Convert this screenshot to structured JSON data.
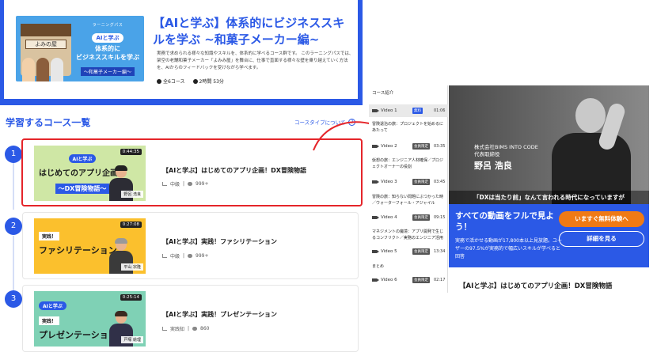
{
  "banner": {
    "hero_small": "ラーニングパス",
    "hero_ai": "AIと学ぶ",
    "hero_main": "体系的に\nビジネススキルを学ぶ",
    "hero_sub": "〜和菓子メーカー編〜",
    "hero_sign": "よみの屋",
    "title": "【AIと学ぶ】体系的にビジネススキルを学ぶ ~和菓子メーカー編~",
    "description": "実務で求められる様々な知識やスキルを、体系的に学べるコース群です。 このラーニングパスでは、架空の老舗和菓子メーカー「よみみ屋」を舞台に、仕事で直面する様々な壁を乗り越えていく方法を、AIからのフィードバックを受けながら学べます。",
    "course_count": "全6コース",
    "duration": "2時間 53分"
  },
  "list": {
    "title": "学習するコース一覧",
    "type_link": "コースタイプについて",
    "courses": [
      {
        "num": "1",
        "duration": "0:44:35",
        "thumb_ai": "AIと学ぶ",
        "thumb_main": "はじめてのアプリ企画！",
        "thumb_banner": "〜DX冒険物語〜",
        "thumb_name": "野呂 浩良",
        "title": "【AIと学ぶ】はじめてのアプリ企画！DX冒険物語",
        "level": "中級",
        "count": "999+"
      },
      {
        "num": "2",
        "duration": "0:27:08",
        "thumb_badge": "実践！",
        "thumb_main": "ファシリテーション",
        "thumb_name": "平山 宗隆",
        "title": "【AIと学ぶ】実践！ファシリテーション",
        "level": "中級",
        "count": "999+"
      },
      {
        "num": "3",
        "duration": "0:25:14",
        "thumb_ai": "AIと学ぶ",
        "thumb_badge": "実践！",
        "thumb_main": "プレゼンテーション",
        "thumb_name": "戸塚 絵理",
        "title": "【AIと学ぶ】実践！プレゼンテーション",
        "level": "実践知",
        "count": "860"
      }
    ]
  },
  "intro": {
    "header": "コース紹介",
    "videos": [
      {
        "label": "Video 1",
        "badge": "無料",
        "time": "01:06"
      },
      {
        "label": "Video 2",
        "badge": "会員限定",
        "time": "03:35"
      },
      {
        "label": "Video 3",
        "badge": "会員限定",
        "time": "03:45"
      },
      {
        "label": "Video 4",
        "badge": "会員限定",
        "time": "09:15"
      },
      {
        "label": "Video 5",
        "badge": "会員限定",
        "time": "13:34"
      },
      {
        "label": "Video 6",
        "badge": "会員限定",
        "time": "02:17"
      }
    ],
    "chapters": [
      "冒険退治の旅：プロジェクトを始めるにあたって",
      "仮想の旅：エンジニア人材確保／プロジェクトオーナーの役割",
      "冒険の旅：知らない問題にぶつかった時／ウォーターフォール・アジャイル",
      "マネジメントの魔境：アプリ開発で生じるコンフリクト／実務のエンジニア活用",
      "まとめ"
    ]
  },
  "video": {
    "company": "株式会社BIMS INTO CODE\n代表取締役",
    "name": "野呂 浩良",
    "caption": "「DXは当たり前」なんて言われる時代になっていますが"
  },
  "promo": {
    "title": "すべての動画をフルで見よう！",
    "description": "実務で活かせる動画が17,800本以上見放題。ユーザーの97.5%が実務的で幅広いスキルが学べると回答",
    "trial_button": "いますぐ無料体験へ",
    "detail_button": "詳細を見る"
  },
  "video_title": "【AIと学ぶ】はじめてのアプリ企画！DX冒険物語",
  "colors": {
    "brand_blue": "#2b59e6",
    "highlight_red": "#e5252a",
    "cta_orange": "#f07a15",
    "free_badge": "#2b59e6",
    "member_badge": "#555555"
  }
}
